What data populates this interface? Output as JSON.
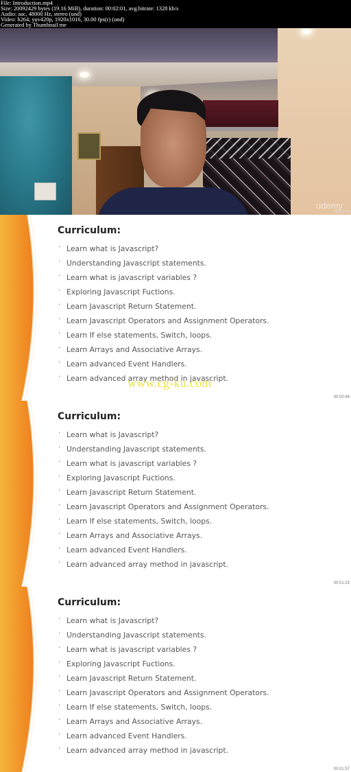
{
  "file_info": {
    "lines": [
      "File: Introduction.mp4",
      "Size: 20092429 bytes (19.16 MiB), duration: 00:02:01, avg.bitrate: 1328 kb/s",
      "Audio: aac, 48000 Hz, stereo (und)",
      "Video: h264, yuv420p, 1920x1016, 30.00 fps(r) (und)",
      "Generated by Thumbnail me"
    ]
  },
  "video_frame": {
    "logo": "udemy",
    "timestamp": "00:00:05"
  },
  "slides": [
    {
      "title": "Curriculum:",
      "timestamp": "00:00:48",
      "items": [
        "Learn what is Javascript?",
        "Understanding Javascript statements.",
        "Learn what is javascript variables ?",
        "Exploring Javascript Fuctions.",
        "Learn Javascript Return Statement.",
        "Learn Javascript Operators and Assignment Operators.",
        "Learn If else statements, Switch, loops.",
        "Learn Arrays and Associative Arrays.",
        "Learn advanced Event Handlers.",
        "Learn advanced array method in javascript."
      ]
    },
    {
      "title": "Curriculum:",
      "timestamp": "00:01:23",
      "items": [
        "Learn what is Javascript?",
        "Understanding Javascript statements.",
        "Learn what is javascript variables ?",
        "Exploring Javascript Fuctions.",
        "Learn Javascript Return Statement.",
        "Learn Javascript Operators and Assignment Operators.",
        "Learn If else statements, Switch, loops.",
        "Learn Arrays and Associative Arrays.",
        "Learn advanced Event Handlers.",
        "Learn advanced array method in javascript."
      ]
    },
    {
      "title": "Curriculum:",
      "timestamp": "00:01:57",
      "items": [
        "Learn what is Javascript?",
        "Understanding Javascript statements.",
        "Learn what is javascript variables ?",
        "Exploring Javascript Fuctions.",
        "Learn Javascript Return Statement.",
        "Learn Javascript Operators and Assignment Operators.",
        "Learn If else statements, Switch, loops.",
        "Learn Arrays and Associative Arrays.",
        "Learn advanced Event Handlers.",
        "Learn advanced array method in javascript."
      ]
    }
  ],
  "bullet_glyph": "·",
  "watermark": "www.cg-ku.com",
  "colors": {
    "accent_orange": "#f08a24",
    "accent_yellow": "#f4b53a",
    "watermark": "#e9dc1f"
  }
}
